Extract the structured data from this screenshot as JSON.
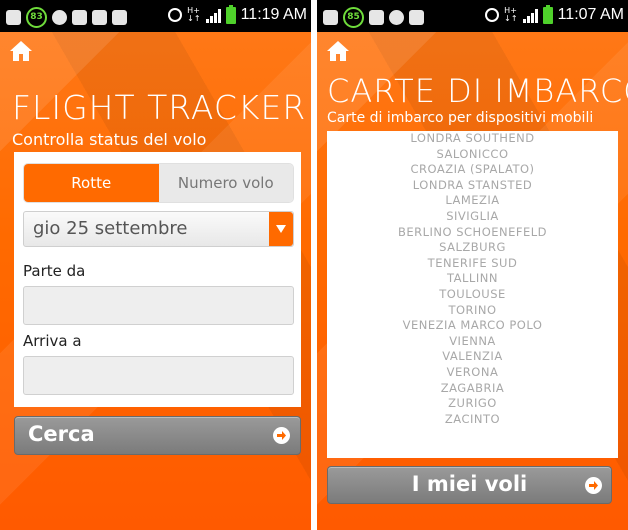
{
  "left": {
    "status_time": "11:19 AM",
    "status_badge": "83",
    "title": "FLIGHT TRACKER",
    "subtitle": "Controlla status del volo",
    "tabs": [
      {
        "label": "Rotte",
        "active": true
      },
      {
        "label": "Numero volo",
        "active": false
      }
    ],
    "date_value": "gio 25 settembre",
    "from_label": "Parte da",
    "to_label": "Arriva a",
    "search_button": "Cerca"
  },
  "right": {
    "status_time": "11:07 AM",
    "status_badge": "85",
    "title": "CARTE DI IMBARCO",
    "subtitle": "Carte di imbarco per dispositivi mobili",
    "destinations": [
      "LONDRA SOUTHEND",
      "SALONICCO",
      "CROAZIA (SPALATO)",
      "LONDRA STANSTED",
      "LAMEZIA",
      "SIVIGLIA",
      "BERLINO SCHOENEFELD",
      "SALZBURG",
      "TENERIFE SUD",
      "TALLINN",
      "TOULOUSE",
      "TORINO",
      "VENEZIA MARCO POLO",
      "VIENNA",
      "VALENZIA",
      "VERONA",
      "ZAGABRIA",
      "ZURIGO",
      "ZACINTO"
    ],
    "my_flights_button": "I miei voli"
  },
  "colors": {
    "brand_orange": "#ff6a00",
    "button_gray": "#8a8a8a",
    "battery_green": "#4fd12b"
  }
}
